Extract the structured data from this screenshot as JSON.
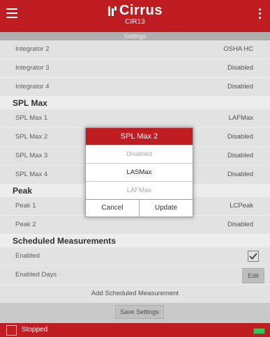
{
  "app": {
    "brand": "Cirrus",
    "device": "CIR13",
    "page_title": "Settings"
  },
  "settings": {
    "integrator": [
      {
        "label": "Integrator 2",
        "value": "OSHA HC"
      },
      {
        "label": "Integrator 3",
        "value": "Disabled"
      },
      {
        "label": "Integrator 4",
        "value": "Disabled"
      }
    ],
    "spl_max_title": "SPL Max",
    "spl_max": [
      {
        "label": "SPL Max 1",
        "value": "LAFMax"
      },
      {
        "label": "SPL Max 2",
        "value": "Disabled"
      },
      {
        "label": "SPL Max 3",
        "value": "Disabled"
      },
      {
        "label": "SPL Max 4",
        "value": "Disabled"
      }
    ],
    "peak_title": "Peak",
    "peak": [
      {
        "label": "Peak 1",
        "value": "LCPeak"
      },
      {
        "label": "Peak 2",
        "value": "Disabled"
      }
    ],
    "scheduled_title": "Scheduled Measurements",
    "enabled_label": "Enabled",
    "enabled_checked": true,
    "enabled_days_label": "Enabled Days",
    "edit_label": "Edit",
    "add_label": "Add Scheduled Measurement",
    "save_label": "Save Settings"
  },
  "status": {
    "text": "Stopped"
  },
  "dialog": {
    "title": "SPL Max 2",
    "options": [
      "Disabled",
      "LASMax",
      "LAFMax"
    ],
    "selected": "LASMax",
    "cancel": "Cancel",
    "update": "Update"
  }
}
